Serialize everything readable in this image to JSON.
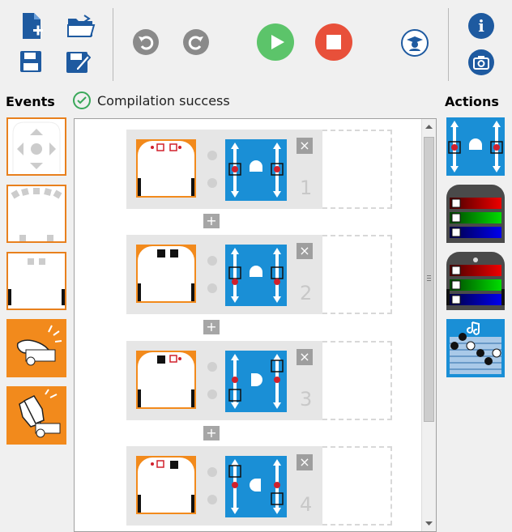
{
  "toolbar": {
    "new_file": "new-file-icon",
    "open_file": "open-folder-icon",
    "save": "save-icon",
    "save_as": "save-as-icon",
    "undo": "undo-icon",
    "redo": "redo-icon",
    "run": "play-icon",
    "stop": "stop-icon",
    "advanced": "graduate-icon",
    "info": "info-icon",
    "screenshot": "camera-icon",
    "info_glyph": "i"
  },
  "events_title": "Events",
  "actions_title": "Actions",
  "status": {
    "text": "Compilation success",
    "color": "#3aa85a"
  },
  "colors": {
    "orange": "#f28a1c",
    "blue": "#1a8fd6",
    "green": "#5cc46a",
    "red": "#e8503a",
    "navy": "#1e5aa0"
  },
  "events": [
    "buttons-event-icon",
    "prox-front-event-icon",
    "prox-ground-event-icon",
    "tap-event-icon",
    "clap-event-icon"
  ],
  "actions": [
    "motors-action-icon",
    "top-color-action-icon",
    "bottom-color-action-icon",
    "music-action-icon"
  ],
  "program": {
    "pairs": [
      {
        "number": "1",
        "delete_label": "×"
      },
      {
        "number": "2",
        "delete_label": "×"
      },
      {
        "number": "3",
        "delete_label": "×"
      },
      {
        "number": "4",
        "delete_label": "×"
      }
    ],
    "add_label": "+"
  }
}
